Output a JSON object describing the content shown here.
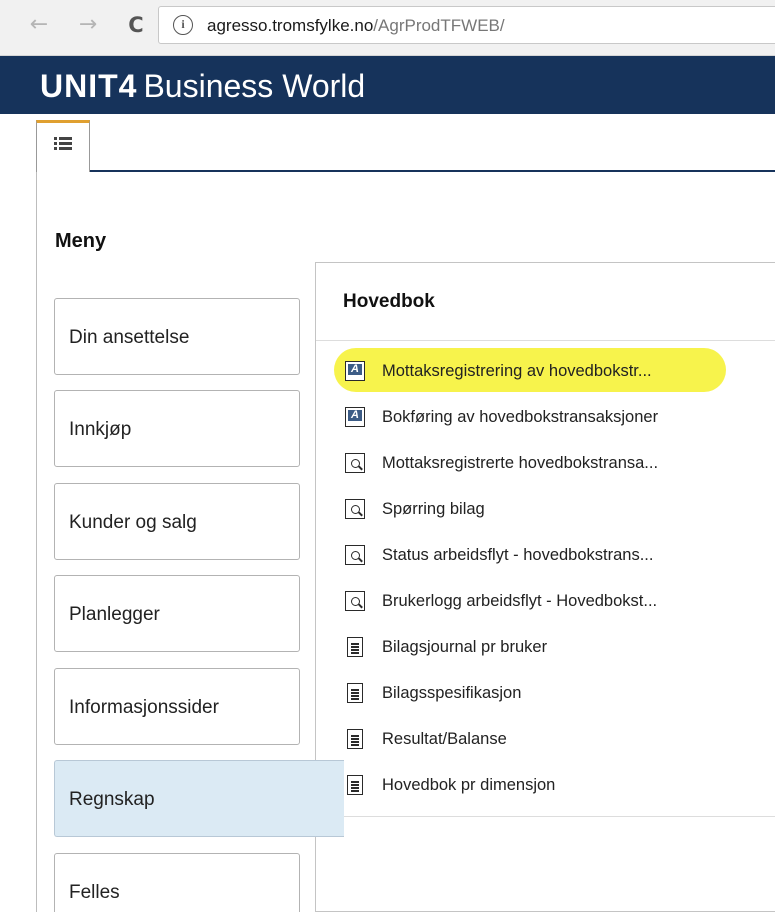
{
  "browser": {
    "back_glyph": "←",
    "forward_glyph": "→",
    "reload_glyph": "C",
    "info_glyph": "i",
    "url_host": "agresso.tromsfylke.no",
    "url_path": "/AgrProdTFWEB/"
  },
  "app": {
    "brand": "UNIT4",
    "product": "Business World",
    "header_color": "#16335b"
  },
  "menu": {
    "title": "Meny",
    "categories": [
      {
        "label": "Din ansettelse",
        "active": false
      },
      {
        "label": "Innkjøp",
        "active": false
      },
      {
        "label": "Kunder og salg",
        "active": false
      },
      {
        "label": "Planlegger",
        "active": false
      },
      {
        "label": "Informasjonssider",
        "active": false
      },
      {
        "label": "Regnskap",
        "active": true
      },
      {
        "label": "Felles",
        "active": false
      }
    ]
  },
  "panel": {
    "title": "Hovedbok",
    "items": [
      {
        "label": "Mottaksregistrering av hovedbokstr...",
        "icon": "application-icon",
        "highlighted": true
      },
      {
        "label": "Bokføring av hovedbokstransaksjoner",
        "icon": "application-icon",
        "highlighted": false
      },
      {
        "label": "Mottaksregistrerte hovedbokstransa...",
        "icon": "query-icon",
        "highlighted": false
      },
      {
        "label": "Spørring bilag",
        "icon": "query-icon",
        "highlighted": false
      },
      {
        "label": "Status arbeidsflyt - hovedbokstrans...",
        "icon": "query-icon",
        "highlighted": false
      },
      {
        "label": "Brukerlogg arbeidsflyt - Hovedbokst...",
        "icon": "query-icon",
        "highlighted": false
      },
      {
        "label": "Bilagsjournal pr bruker",
        "icon": "report-icon",
        "highlighted": false
      },
      {
        "label": "Bilagsspesifikasjon",
        "icon": "report-icon",
        "highlighted": false
      },
      {
        "label": "Resultat/Balanse",
        "icon": "report-icon",
        "highlighted": false
      },
      {
        "label": "Hovedbok pr dimensjon",
        "icon": "report-icon",
        "highlighted": false
      }
    ]
  },
  "colors": {
    "highlight": "#f6f238",
    "active_category": "#dbeaf4",
    "tab_accent": "#e0a030"
  }
}
